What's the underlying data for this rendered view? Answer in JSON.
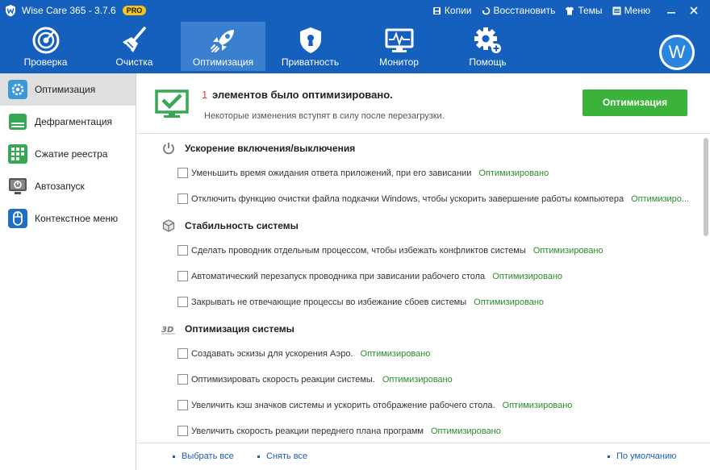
{
  "app": {
    "title": "Wise Care 365 - 3.7.6",
    "badge": "PRO"
  },
  "titlebar_menu": [
    {
      "icon": "backup-icon",
      "label": "Копии"
    },
    {
      "icon": "restore-icon",
      "label": "Восстановить"
    },
    {
      "icon": "shirt-icon",
      "label": "Темы"
    },
    {
      "icon": "menu-icon",
      "label": "Меню"
    }
  ],
  "nav_tabs": [
    {
      "icon": "radar-icon",
      "label": "Проверка",
      "active": false
    },
    {
      "icon": "broom-icon",
      "label": "Очистка",
      "active": false
    },
    {
      "icon": "rocket-icon",
      "label": "Оптимизация",
      "active": true
    },
    {
      "icon": "shield-lock-icon",
      "label": "Приватность",
      "active": false
    },
    {
      "icon": "monitor-icon",
      "label": "Монитор",
      "active": false
    },
    {
      "icon": "gear-plus-icon",
      "label": "Помощь",
      "active": false
    }
  ],
  "avatar": {
    "letter": "W"
  },
  "sidebar": {
    "items": [
      {
        "icon": "gear-optimize-icon",
        "label": "Оптимизация",
        "active": true
      },
      {
        "icon": "defrag-icon",
        "label": "Дефрагментация",
        "active": false
      },
      {
        "icon": "registry-compress-icon",
        "label": "Сжатие реестра",
        "active": false
      },
      {
        "icon": "startup-icon",
        "label": "Автозапуск",
        "active": false
      },
      {
        "icon": "context-menu-icon",
        "label": "Контекстное меню",
        "active": false
      }
    ]
  },
  "banner": {
    "count": "1",
    "headline": "элементов было оптимизировано.",
    "note": "Некоторые изменения вступят в силу после перезагрузки.",
    "button": "Оптимизация"
  },
  "sections": [
    {
      "icon": "power-icon",
      "title": "Ускорение включения/выключения",
      "items": [
        {
          "text": "Уменьшить время ожидания ответа приложений, при его зависании",
          "status": "Оптимизировано"
        },
        {
          "text": "Отключить функцию очистки файла подкачки Windows, чтобы ускорить завершение работы компьютера",
          "status": "Оптимизиро..."
        }
      ]
    },
    {
      "icon": "cube-icon",
      "title": "Стабильность системы",
      "items": [
        {
          "text": "Сделать проводник отдельным процессом, чтобы избежать конфликтов системы",
          "status": "Оптимизировано"
        },
        {
          "text": "Автоматический перезапуск проводника при зависании рабочего стола",
          "status": "Оптимизировано"
        },
        {
          "text": "Закрывать не отвечающие процессы во избежание сбоев системы",
          "status": "Оптимизировано"
        }
      ]
    },
    {
      "icon": "3d-icon",
      "title": "Оптимизация системы",
      "items": [
        {
          "text": "Создавать эскизы для ускорения Аэро.",
          "status": "Оптимизировано"
        },
        {
          "text": "Оптимизировать скорость реакции системы.",
          "status": "Оптимизировано"
        },
        {
          "text": "Увеличить кэш значков системы и ускорить отображение рабочего стола.",
          "status": "Оптимизировано"
        },
        {
          "text": "Увеличить скорость реакции переднего плана программ",
          "status": "Оптимизировано"
        }
      ]
    }
  ],
  "footer": {
    "select_all": "Выбрать все",
    "deselect_all": "Снять все",
    "default": "По умолчанию"
  }
}
